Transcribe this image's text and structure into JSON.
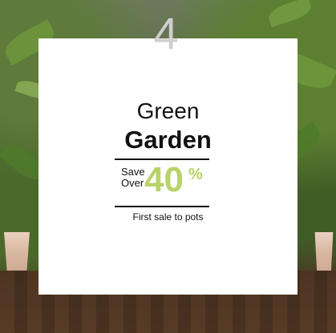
{
  "promo": {
    "number": "4",
    "title_line1": "Green",
    "title_line2": "Garden",
    "save_line1": "Save",
    "save_line2": "Over",
    "discount": "40",
    "discount_suffix": "%",
    "subtext": "First sale to pots",
    "accent_color": "#b8d36a"
  }
}
